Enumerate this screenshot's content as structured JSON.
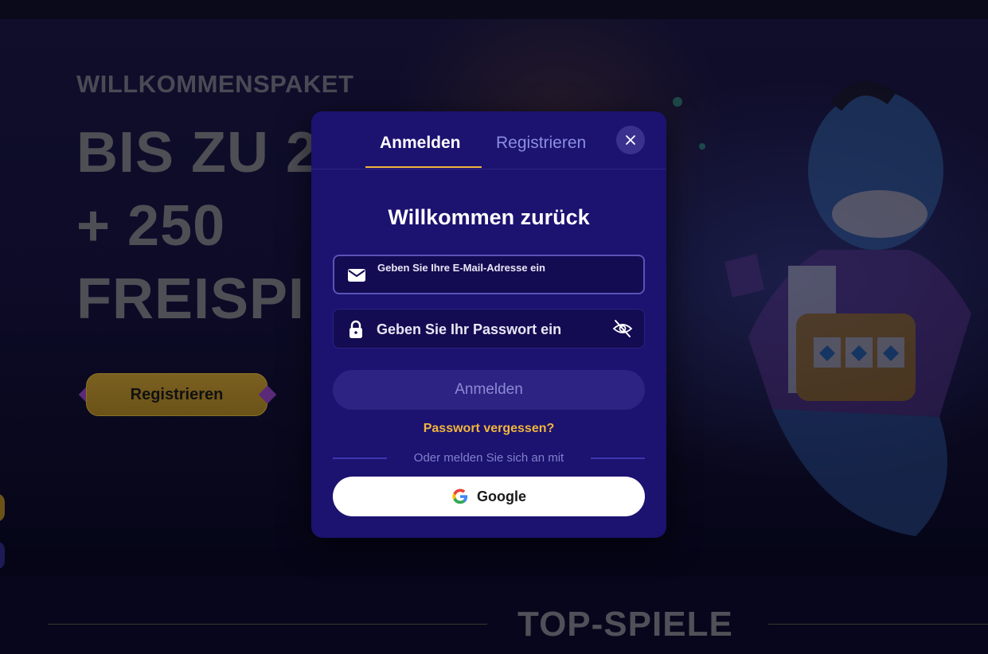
{
  "hero": {
    "eyebrow": "WILLKOMMENSPAKET",
    "line1": "BIS ZU 2",
    "line2": "+ 250",
    "line3": "FREISPI",
    "cta_label": "Registrieren"
  },
  "section": {
    "title": "TOP-SPIELE"
  },
  "modal": {
    "tabs": {
      "login": "Anmelden",
      "register": "Registrieren"
    },
    "title": "Willkommen zurück",
    "email_placeholder": "Geben Sie Ihre E-Mail-Adresse ein",
    "password_placeholder": "Geben Sie Ihr Passwort ein",
    "submit_label": "Anmelden",
    "forgot_label": "Passwort vergessen?",
    "divider_text": "Oder melden Sie sich an mit",
    "google_label": "Google"
  },
  "colors": {
    "modal_bg": "#1c1270",
    "accent_gold": "#f0b63c",
    "field_bg": "#140c52",
    "submit_bg": "#2c2383"
  },
  "icons": {
    "close": "close-icon",
    "email": "envelope-icon",
    "password": "lock-icon",
    "visibility": "eye-slash-icon",
    "google": "google-logo-icon"
  }
}
